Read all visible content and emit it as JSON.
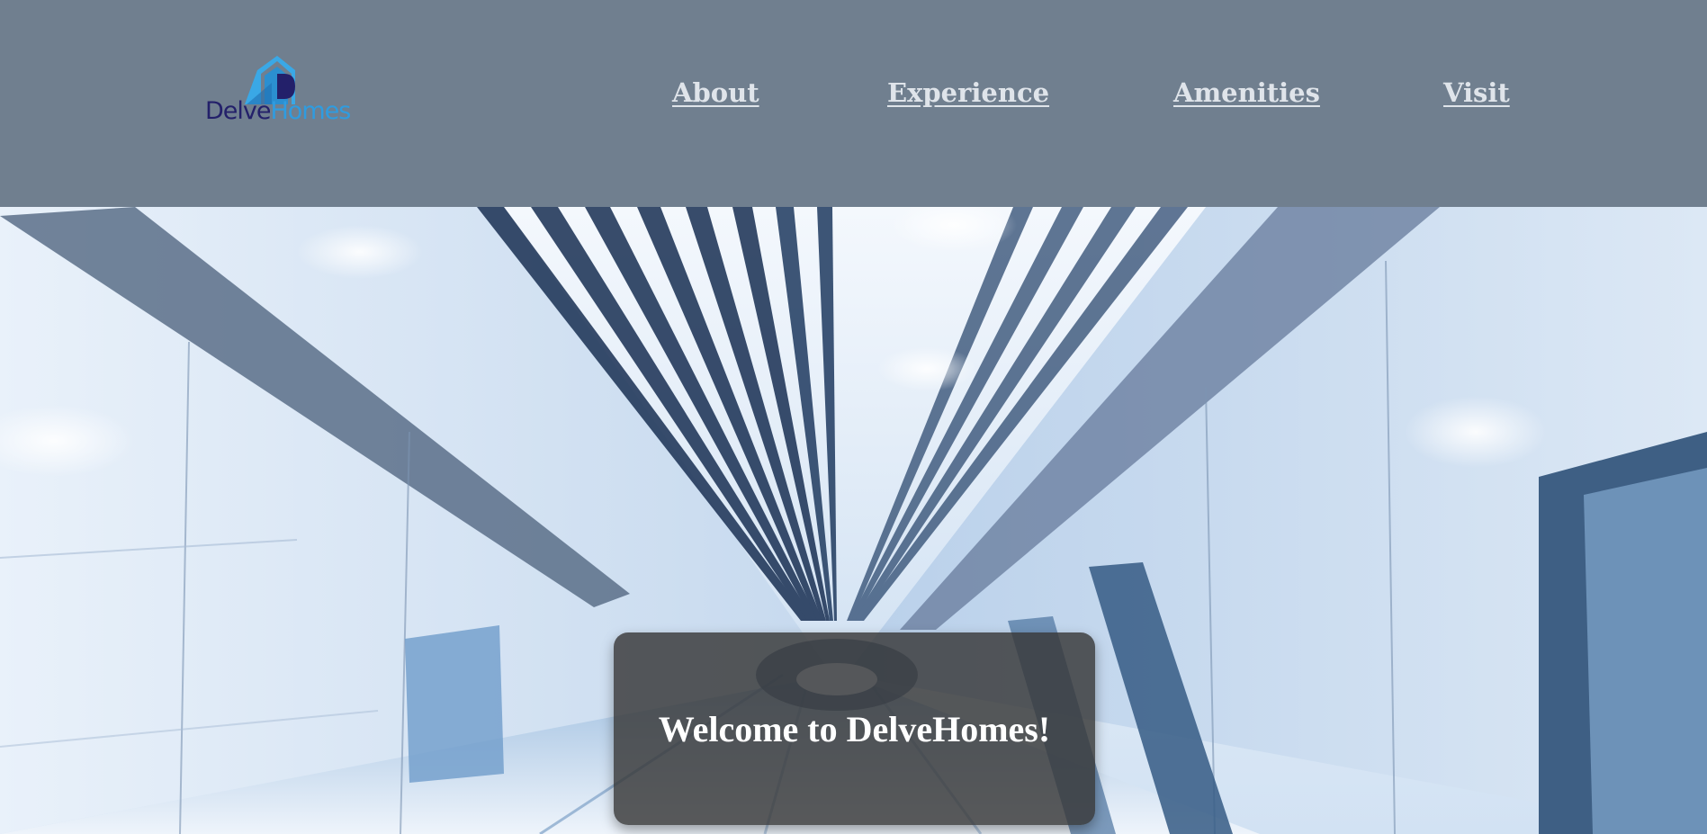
{
  "brand": {
    "logo_word_1": "Delve",
    "logo_word_2": "Homes",
    "colors": {
      "dark": "#23206a",
      "light": "#2f9ce0"
    }
  },
  "header": {
    "background": "#707f8f"
  },
  "nav": {
    "items": [
      {
        "label": "About"
      },
      {
        "label": "Experience"
      },
      {
        "label": "Amenities"
      },
      {
        "label": "Visit"
      }
    ]
  },
  "hero": {
    "image_icon": "futuristic-corridor-image",
    "welcome": "Welcome to DelveHomes!"
  }
}
